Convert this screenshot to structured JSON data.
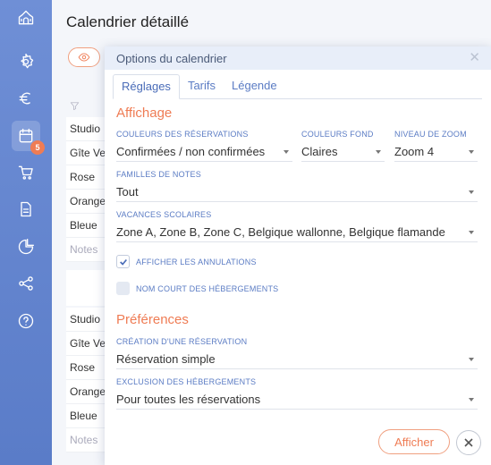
{
  "page": {
    "title": "Calendrier détaillé"
  },
  "sidebar": {
    "cart_badge": "5"
  },
  "background_list_a": [
    "Studio",
    "Gîte Ve",
    "Rose",
    "Orange",
    "Bleue",
    "Notes"
  ],
  "background_list_b": [
    "Studio",
    "Gîte Ve",
    "Rose",
    "Orange",
    "Bleue",
    "Notes"
  ],
  "modal": {
    "title": "Options du calendrier",
    "tabs": [
      "Réglages",
      "Tarifs",
      "Légende"
    ],
    "affichage": {
      "title": "Affichage",
      "couleurs_reservations": {
        "label": "Couleurs des réservations",
        "value": "Confirmées / non confirmées"
      },
      "couleurs_fond": {
        "label": "Couleurs fond",
        "value": "Claires"
      },
      "niveau_zoom": {
        "label": "Niveau de zoom",
        "value": "Zoom 4"
      },
      "familles_notes": {
        "label": "Familles de notes",
        "value": "Tout"
      },
      "vacances": {
        "label": "Vacances scolaires",
        "value": "Zone A, Zone B, Zone C, Belgique wallonne, Belgique flamande"
      },
      "afficher_annulations": {
        "label": "Afficher les annulations",
        "checked": true
      },
      "nom_court": {
        "label": "Nom court des hébergements",
        "checked": false
      }
    },
    "preferences": {
      "title": "Préférences",
      "creation": {
        "label": "Création d'une réservation",
        "value": "Réservation simple"
      },
      "exclusion": {
        "label": "Exclusion des hébergements",
        "value": "Pour toutes les réservations"
      }
    },
    "apply_label": "Afficher"
  }
}
